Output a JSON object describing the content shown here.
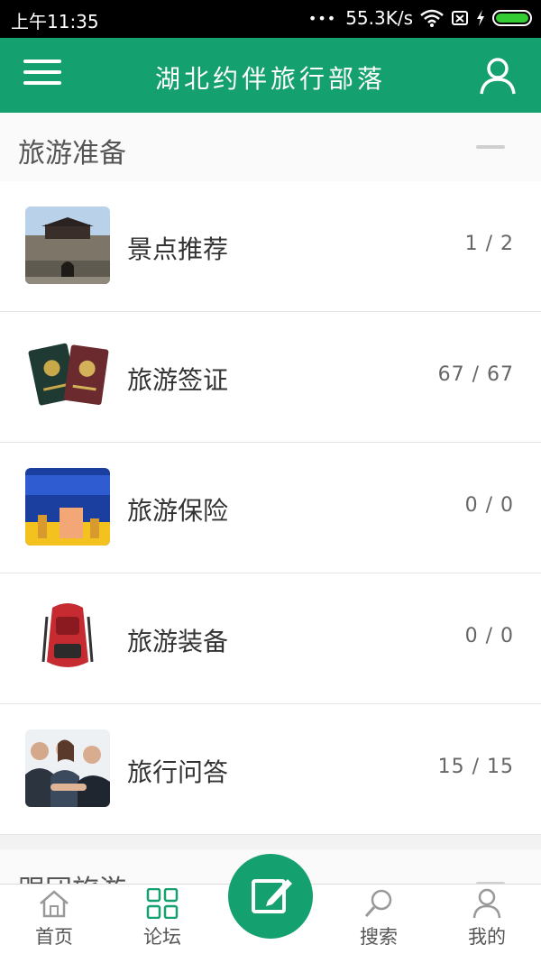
{
  "status_bar": {
    "time": "上午11:35",
    "network_speed": "55.3K/s",
    "dots": "•••"
  },
  "header": {
    "title": "湖北约伴旅行部落"
  },
  "sections": [
    {
      "label": "旅游准备",
      "items": [
        {
          "name": "景点推荐",
          "count": "1 / 2",
          "thumb": "city-gate"
        },
        {
          "name": "旅游签证",
          "count": "67 / 67",
          "thumb": "passports"
        },
        {
          "name": "旅游保险",
          "count": "0 / 0",
          "thumb": "insurance"
        },
        {
          "name": "旅游装备",
          "count": "0 / 0",
          "thumb": "backpack"
        },
        {
          "name": "旅行问答",
          "count": "15 / 15",
          "thumb": "people"
        }
      ]
    },
    {
      "label": "跟团旅游"
    }
  ],
  "bottom_nav": {
    "home": "首页",
    "forum": "论坛",
    "search": "搜索",
    "me": "我的"
  },
  "colors": {
    "brand": "#14a06f",
    "battery": "#33cc33"
  }
}
